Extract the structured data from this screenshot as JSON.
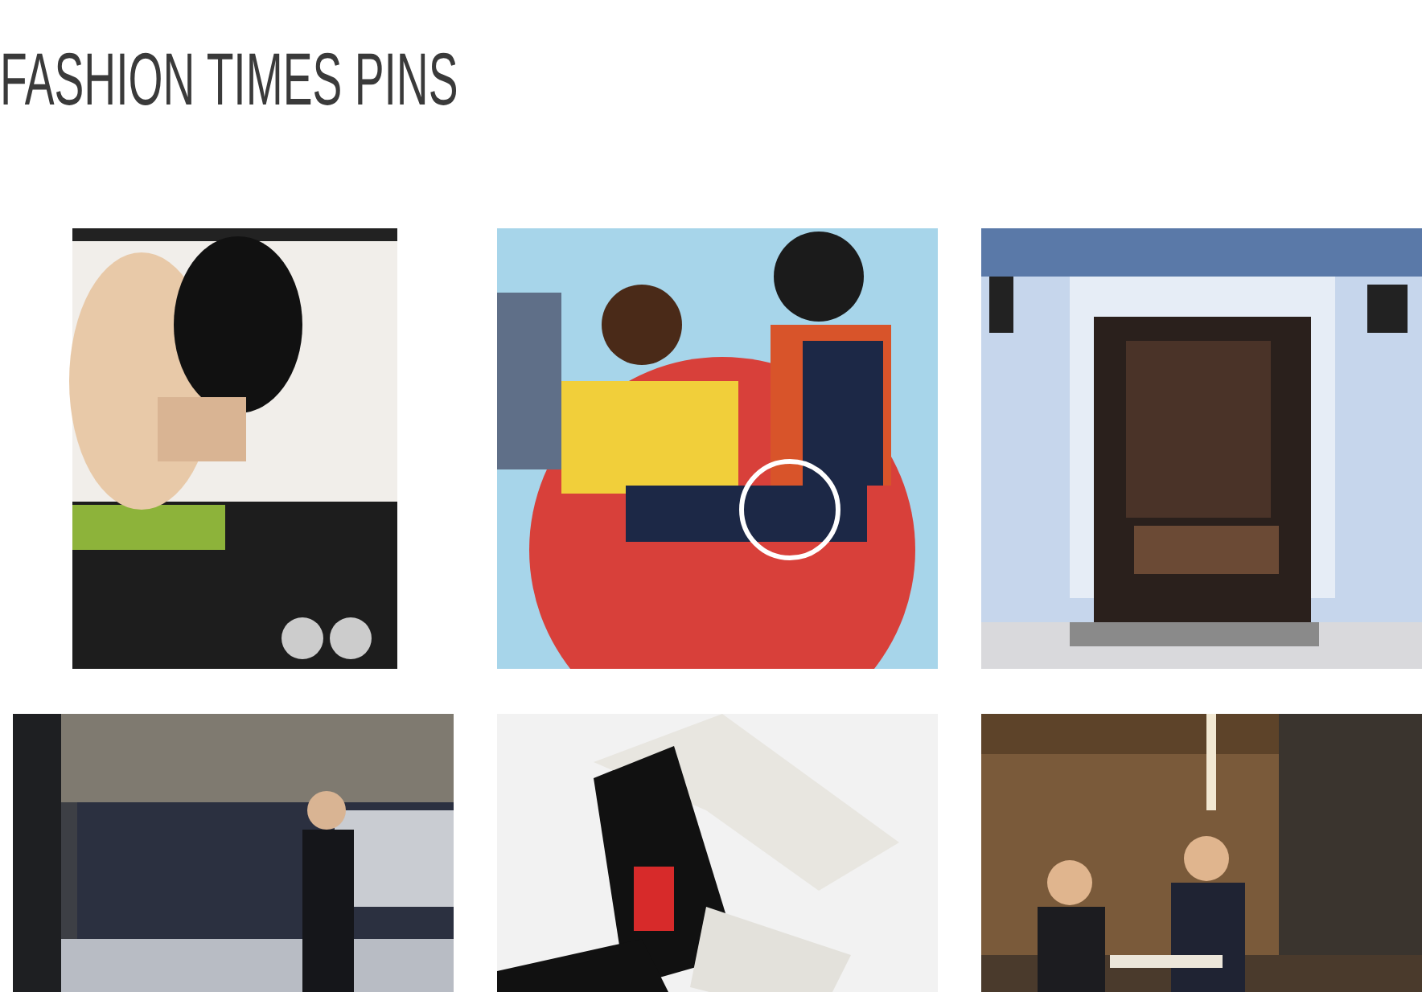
{
  "page": {
    "title": "FASHION TIMES PINS"
  }
}
